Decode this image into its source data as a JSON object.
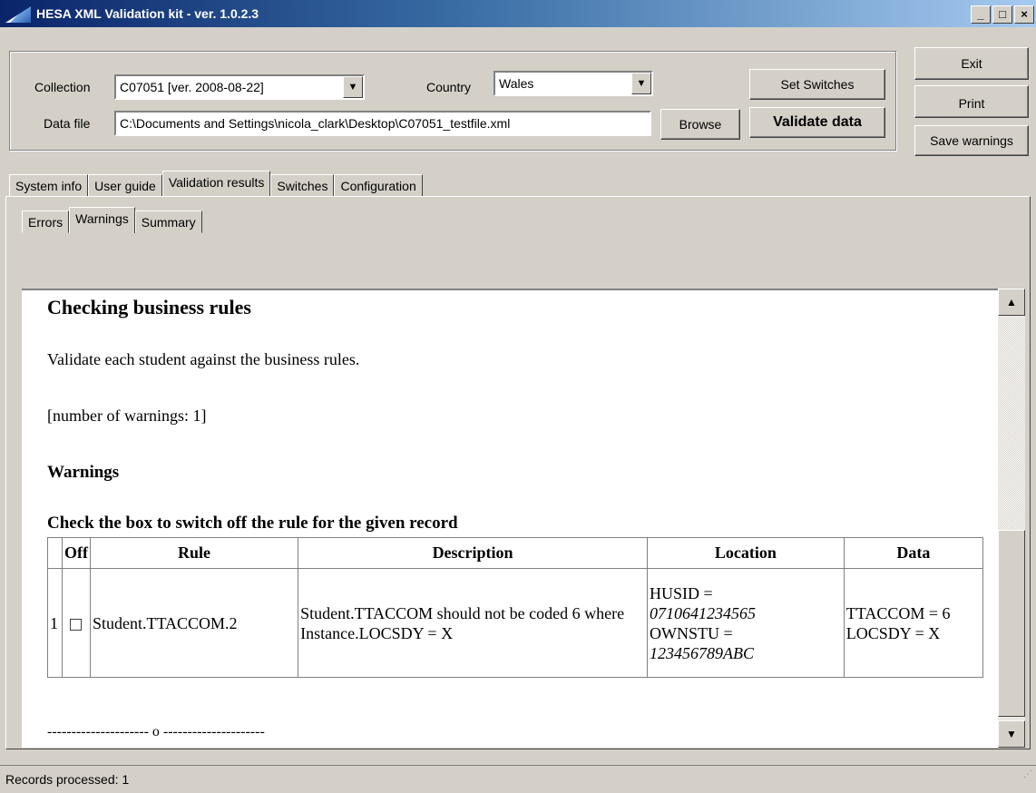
{
  "window": {
    "title": "HESA XML Validation kit - ver. 1.0.2.3",
    "min": "_",
    "max": "□",
    "close": "×"
  },
  "form": {
    "collection_label": "Collection",
    "collection_value": "C07051 [ver. 2008-08-22]",
    "country_label": "Country",
    "country_value": "Wales",
    "datafile_label": "Data file",
    "datafile_value": "C:\\Documents and Settings\\nicola_clark\\Desktop\\C07051_testfile.xml",
    "browse": "Browse",
    "set_switches": "Set Switches",
    "validate": "Validate data"
  },
  "side_buttons": {
    "exit": "Exit",
    "print": "Print",
    "save_warnings": "Save warnings"
  },
  "main_tabs": [
    "System info",
    "User guide",
    "Validation results",
    "Switches",
    "Configuration"
  ],
  "sub_tabs": [
    "Errors",
    "Warnings",
    "Summary"
  ],
  "report": {
    "heading": "Checking business rules",
    "description": "Validate each student against the business rules.",
    "count": "[number of warnings: 1]",
    "section": "Warnings",
    "instruction": "Check the box to switch off the rule for the given record",
    "columns": [
      "Off",
      "Rule",
      "Description",
      "Location",
      "Data"
    ],
    "row": {
      "num": "1",
      "rule": "Student.TTACCOM.2",
      "description": "Student.TTACCOM should not be coded 6 where Instance.LOCSDY = X",
      "loc1_label": "HUSID =",
      "loc1_value": "0710641234565",
      "loc2_label": "OWNSTU =",
      "loc2_value": "123456789ABC",
      "data": "TTACCOM = 6 LOCSDY = X"
    },
    "divider": "--------------------- o ---------------------"
  },
  "status": "Records processed: 1"
}
